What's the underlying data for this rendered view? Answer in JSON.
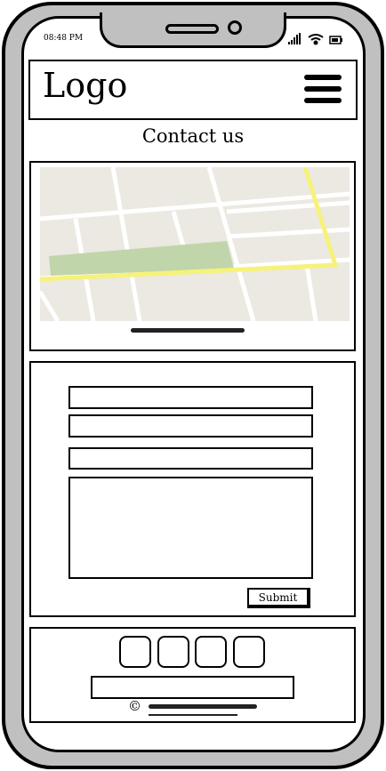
{
  "status_bar": {
    "time": "08:48 PM",
    "icons": [
      "signal-icon",
      "wifi-icon",
      "battery-icon"
    ]
  },
  "header": {
    "logo": "Logo",
    "menu_icon": "hamburger-icon"
  },
  "page": {
    "title": "Contact us"
  },
  "map": {
    "colors": {
      "land": "#ebe9e2",
      "park": "#c1d5aa",
      "road": "#ffffff",
      "highway": "#f6f27a"
    }
  },
  "form": {
    "submit_label": "Submit"
  },
  "footer": {
    "copyright_symbol": "©",
    "social_icon_count": 4
  }
}
